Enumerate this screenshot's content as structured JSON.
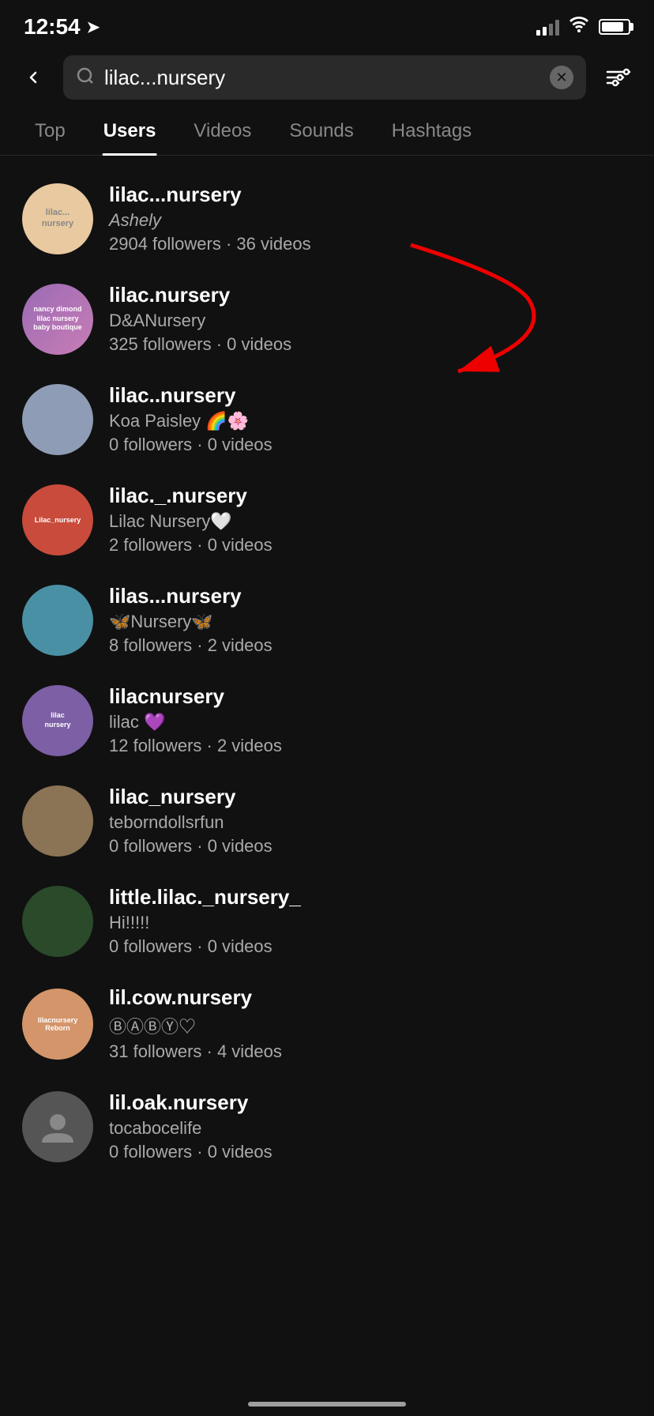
{
  "statusBar": {
    "time": "12:54",
    "locationIcon": "➤"
  },
  "header": {
    "searchQuery": "lilac...nursery",
    "filterIcon": "⚙"
  },
  "tabs": [
    {
      "id": "top",
      "label": "Top",
      "active": false
    },
    {
      "id": "users",
      "label": "Users",
      "active": true
    },
    {
      "id": "videos",
      "label": "Videos",
      "active": false
    },
    {
      "id": "sounds",
      "label": "Sounds",
      "active": false
    },
    {
      "id": "hashtags",
      "label": "Hashtags",
      "active": false
    }
  ],
  "users": [
    {
      "username": "lilac...nursery",
      "displayName": "Ashely",
      "stats": "2904 followers · 36 videos",
      "avatarStyle": "avatar-1",
      "avatarText": ""
    },
    {
      "username": "lilac.nursery",
      "displayName": "D&ANursery",
      "stats": "325 followers · 0 videos",
      "avatarStyle": "avatar-2",
      "avatarText": ""
    },
    {
      "username": "lilac..nursery",
      "displayName": "Koa Paisley 🌈🌸",
      "stats": "0 followers · 0 videos",
      "avatarStyle": "avatar-3",
      "avatarText": ""
    },
    {
      "username": "lilac._.nursery",
      "displayName": "Lilac Nursery🤍",
      "stats": "2 followers · 0 videos",
      "avatarStyle": "avatar-4",
      "avatarText": ""
    },
    {
      "username": "lilas...nursery",
      "displayName": "🦋Nursery🦋",
      "stats": "8 followers · 2 videos",
      "avatarStyle": "avatar-5",
      "avatarText": ""
    },
    {
      "username": "lilacnursery",
      "displayName": "lilac 💜",
      "stats": "12 followers · 2 videos",
      "avatarStyle": "avatar-6",
      "avatarText": ""
    },
    {
      "username": "lilac_nursery",
      "displayName": "teborndollsrfun",
      "stats": "0 followers · 0 videos",
      "avatarStyle": "avatar-7",
      "avatarText": ""
    },
    {
      "username": "little.lilac._nursery_",
      "displayName": "Hi!!!!!",
      "stats": "0 followers · 0 videos",
      "avatarStyle": "avatar-8",
      "avatarText": ""
    },
    {
      "username": "lil.cow.nursery",
      "displayName": "ⒷⒶⒷⓎ♡",
      "stats": "31 followers · 4 videos",
      "avatarStyle": "avatar-9",
      "avatarText": ""
    },
    {
      "username": "lil.oak.nursery",
      "displayName": "tocabocelife",
      "stats": "0 followers · 0 videos",
      "avatarStyle": "avatar-10",
      "avatarText": ""
    }
  ]
}
